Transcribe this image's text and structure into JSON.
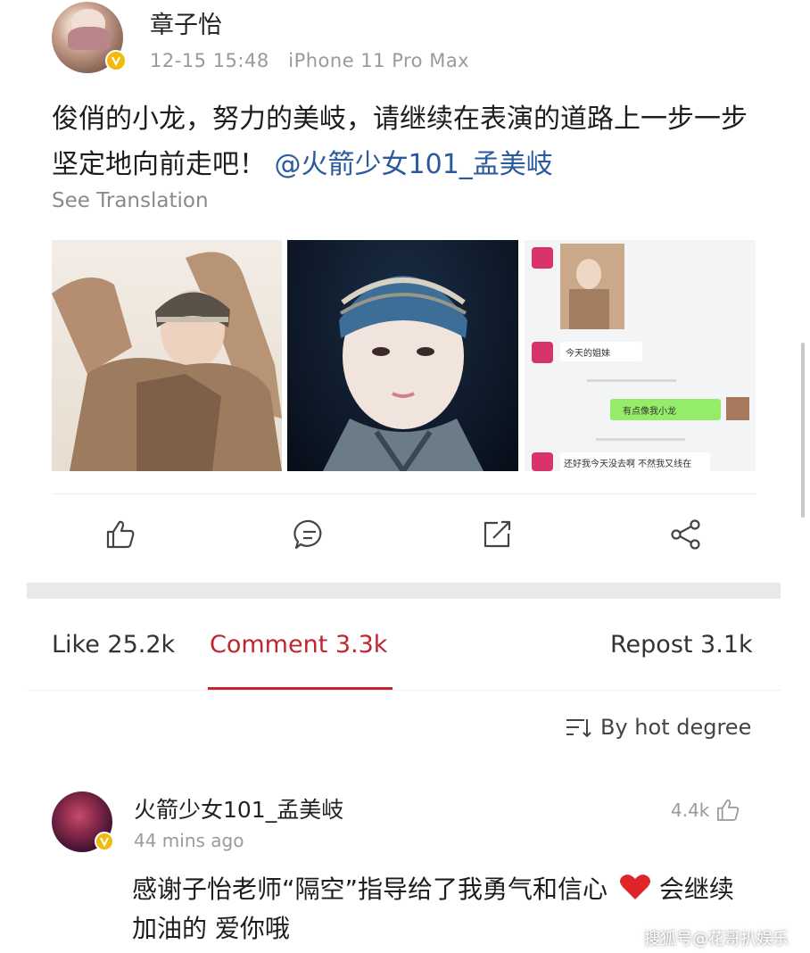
{
  "post": {
    "author": "章子怡",
    "timestamp": "12-15 15:48",
    "device": "iPhone 11 Pro Max",
    "text": "俊俏的小龙，努力的美岐，请继续在表演的道路上一步一步坚定地向前走吧！",
    "mention": "@火箭少女101_孟美岐",
    "see_translation": "See Translation",
    "chat_texts": [
      "今天的姐妹",
      "有点像我小龙",
      "还好我今天没去啊 不然我又线在"
    ]
  },
  "tabs": {
    "like": "Like 25.2k",
    "comment": "Comment 3.3k",
    "repost": "Repost 3.1k"
  },
  "sort": {
    "label": "By hot degree"
  },
  "comment": {
    "author": "火箭少女101_孟美岐",
    "time": "44 mins ago",
    "likes": "4.4k",
    "text": "感谢子怡老师“隔空”指导给了我勇气和信心",
    "text_tail": " 会继续加油的 爱你哦"
  },
  "watermark": "搜狐号@花哥扒娱乐",
  "colors": {
    "accent": "#c0262f",
    "mention": "#2a5a9e",
    "verified": "#f2b90f"
  }
}
